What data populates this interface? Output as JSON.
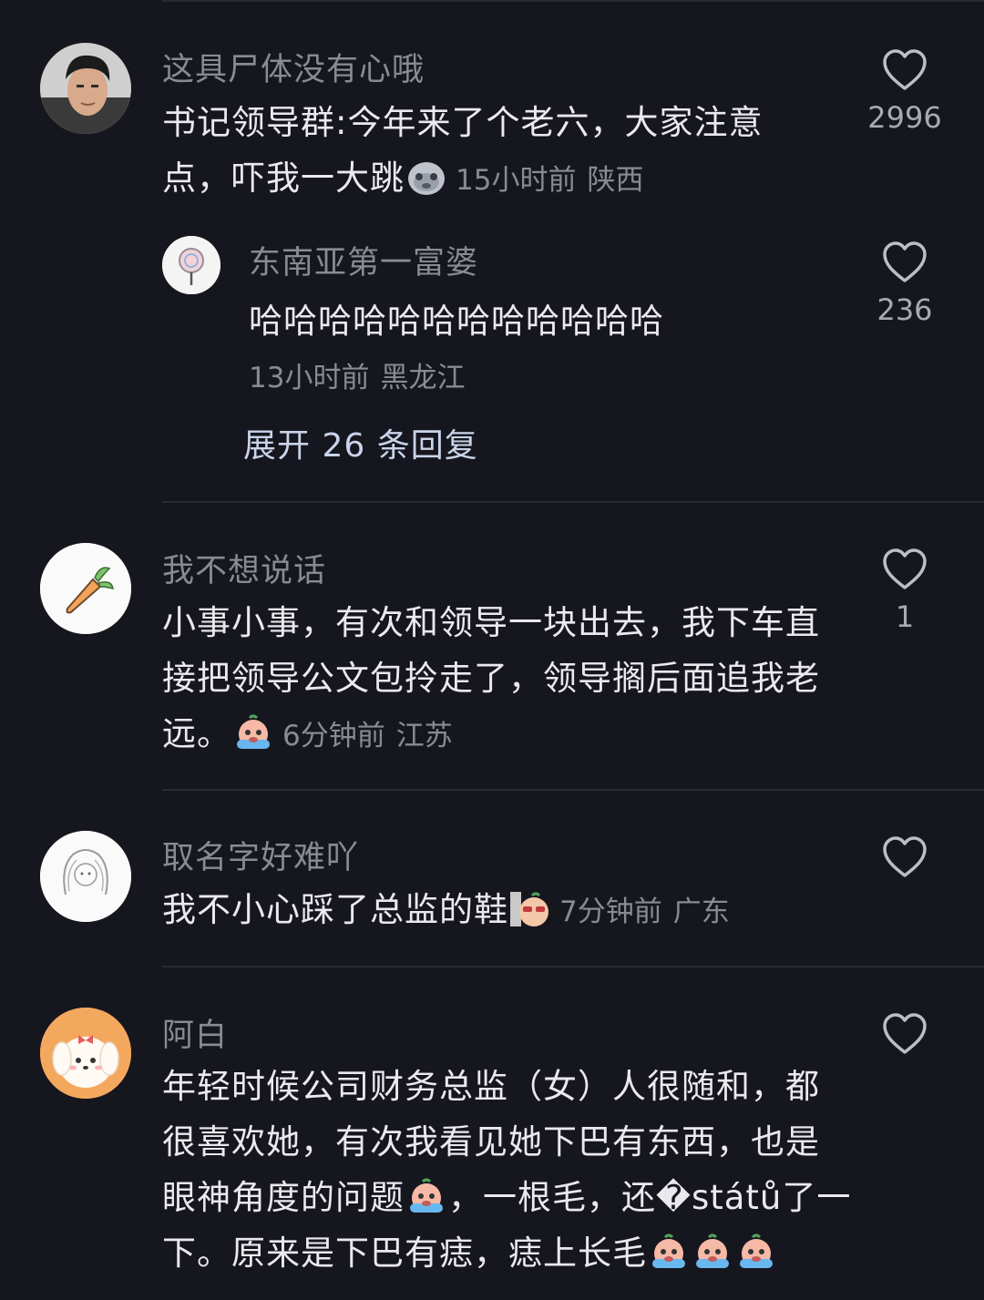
{
  "comments": [
    {
      "username": "这具尸体没有心哦",
      "text_lines": [
        "书记领导群:今年来了个老六，大家注意",
        "点，吓我一大跳"
      ],
      "time": "15小时前",
      "location": "陕西",
      "likes": "2996",
      "emoji": "ghost-emoji",
      "reply": {
        "username": "东南亚第一富婆",
        "text": "哈哈哈哈哈哈哈哈哈哈哈哈",
        "time": "13小时前",
        "location": "黑龙江",
        "likes": "236"
      },
      "expand_label": "展开 26 条回复"
    },
    {
      "username": "我不想说话",
      "text_lines": [
        "小事小事，有次和领导一块出去，我下车直",
        "接把领导公文包拎走了，领导搁后面追我老",
        "远。"
      ],
      "time": "6分钟前",
      "location": "江苏",
      "likes": "1",
      "emoji": "crying-emoji"
    },
    {
      "username": "取名字好难吖",
      "text_lines": [
        "我不小心踩了总监的鞋"
      ],
      "time": "7分钟前",
      "location": "广东",
      "likes": "",
      "emoji": "peek-sunglasses-emoji"
    },
    {
      "username": "阿白",
      "text_lines": [
        "年轻时候公司财务总监（女）人很随和，都",
        "很喜欢她，有次我看见她下巴有东西，也是",
        "眼神角度的问题",
        "，一根毛，还�států了一",
        "下。原来是下巴有痣，痣上长毛"
      ],
      "likes": "",
      "emoji": "crying-emoji"
    }
  ],
  "colors": {
    "background": "#16161e",
    "text": "#e9e9ee",
    "muted": "#8a8a93",
    "link": "#c9d4ea"
  }
}
